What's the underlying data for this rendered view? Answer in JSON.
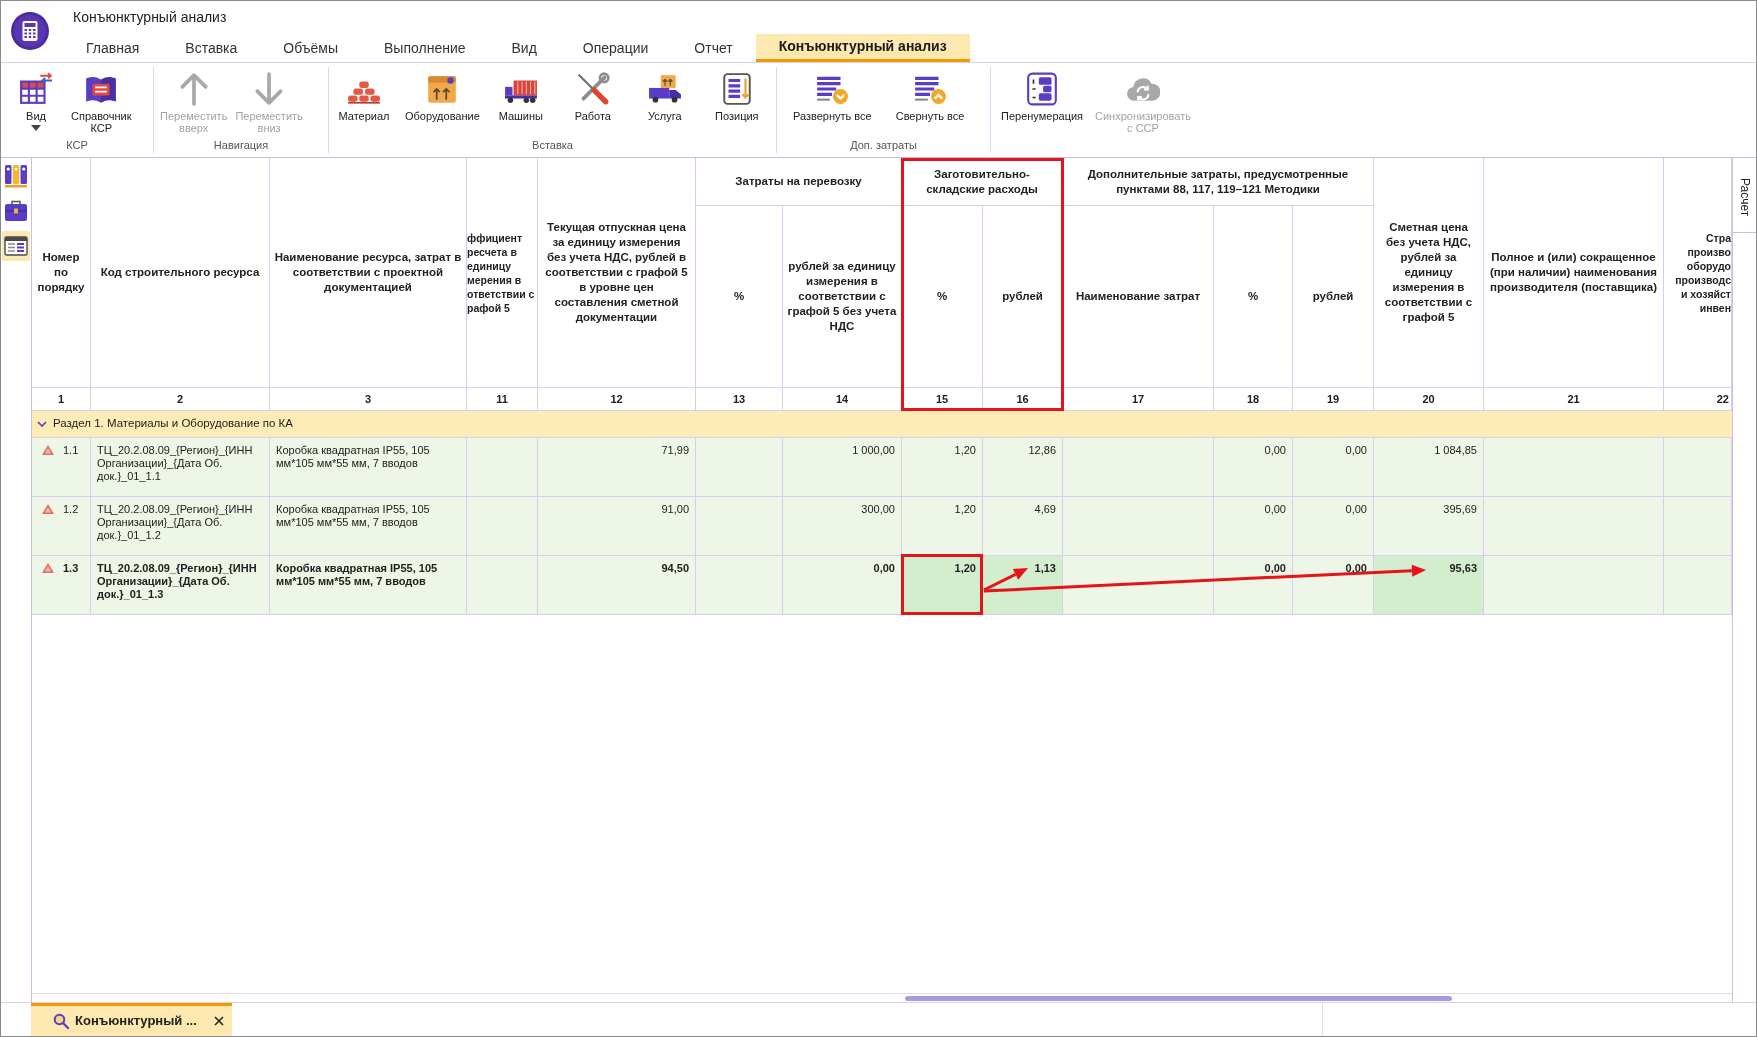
{
  "app": {
    "title": "Конъюнктурный анализ"
  },
  "tabs": [
    {
      "label": "Главная",
      "selected": false
    },
    {
      "label": "Вставка",
      "selected": false
    },
    {
      "label": "Объёмы",
      "selected": false
    },
    {
      "label": "Выполнение",
      "selected": false
    },
    {
      "label": "Вид",
      "selected": false
    },
    {
      "label": "Операции",
      "selected": false
    },
    {
      "label": "Отчет",
      "selected": false
    },
    {
      "label": "Конъюнктурный анализ",
      "selected": true
    }
  ],
  "ribbon": {
    "groups": [
      {
        "label": "КСР",
        "buttons": [
          {
            "label": "Вид",
            "dropdown": true,
            "disabled": false
          },
          {
            "label": "Справочник\nКСР",
            "dropdown": false,
            "disabled": false
          }
        ]
      },
      {
        "label": "Навигация",
        "buttons": [
          {
            "label": "Переместить\nвверх",
            "dropdown": false,
            "disabled": true
          },
          {
            "label": "Переместить\nвниз",
            "dropdown": false,
            "disabled": true
          }
        ]
      },
      {
        "label": "Вставка",
        "buttons": [
          {
            "label": "Материал",
            "dropdown": false,
            "disabled": false
          },
          {
            "label": "Оборудование",
            "dropdown": false,
            "disabled": false
          },
          {
            "label": "Машины",
            "dropdown": false,
            "disabled": false
          },
          {
            "label": "Работа",
            "dropdown": false,
            "disabled": false
          },
          {
            "label": "Услуга",
            "dropdown": false,
            "disabled": false
          },
          {
            "label": "Позиция",
            "dropdown": false,
            "disabled": false
          }
        ]
      },
      {
        "label": "Доп. затраты",
        "buttons": [
          {
            "label": "Развернуть все",
            "dropdown": false,
            "disabled": false
          },
          {
            "label": "Свернуть все",
            "dropdown": false,
            "disabled": false
          }
        ]
      },
      {
        "buttons": [
          {
            "label": "Перенумерация",
            "dropdown": false,
            "disabled": false
          },
          {
            "label": "Синхронизировать\nс ССР",
            "dropdown": false,
            "disabled": true
          }
        ]
      }
    ]
  },
  "side_tools": [
    {
      "selected": false
    },
    {
      "selected": false
    },
    {
      "selected": true
    }
  ],
  "table": {
    "header": [
      {
        "label": "Номер по порядку",
        "number": "1"
      },
      {
        "label": "Код строительного ресурса",
        "number": "2"
      },
      {
        "label": "Наименование ресурса, затрат в соответствии с проектной документацией",
        "number": "3"
      },
      {
        "label": "ффициент\nресчета в\nединицу\nмерения в\nответствии с\nрафой 5",
        "number": "11"
      },
      {
        "label": "Текущая отпускная цена за единицу измерения без учета НДС, рублей в соответствии с графой 5 в уровне цен составления сметной документации",
        "number": "12"
      },
      {
        "label": "Затраты на перевозку",
        "children": [
          {
            "label": "%",
            "number": "13"
          },
          {
            "label": "рублей за единицу измерения в соответствии с графой 5 без учета НДС",
            "number": "14"
          }
        ]
      },
      {
        "label": "Заготовительно-складские расходы",
        "children": [
          {
            "label": "%",
            "number": "15"
          },
          {
            "label": "рублей",
            "number": "16"
          }
        ]
      },
      {
        "label": "Дополнительные затраты, предусмотренные пунктами 88, 117, 119–121 Методики",
        "children": [
          {
            "label": "Наименование затрат",
            "number": "17"
          },
          {
            "label": "%",
            "number": "18"
          },
          {
            "label": "рублей",
            "number": "19"
          }
        ]
      },
      {
        "label": "Сметная цена без учета НДС, рублей за единицу измерения в соответствии с графой 5",
        "number": "20"
      },
      {
        "label": "Полное и (или) сокращенное (при наличии) наименования производителя (поставщика)",
        "number": "21"
      },
      {
        "label": "Стра\nпроизво\nоборудо\nпроизводс\nи хозяйст\nинвен",
        "number": "22"
      }
    ],
    "sections": [
      {
        "title": "Раздел 1. Материалы и Оборудование по КА",
        "expanded": true,
        "rows": [
          {
            "number": "1.1",
            "flagged": true,
            "selected": false,
            "cells": [
              {
                "value": "ТЦ_20.2.08.09_{Регион}_{ИНН Организации}_{Дата Об. док.}_01_1.1",
                "highlighted": false
              },
              {
                "value": "Коробка квадратная IP55, 105 мм*105 мм*55 мм, 7 вводов",
                "highlighted": false
              },
              {
                "highlighted": false
              },
              {
                "value": "71,99",
                "highlighted": false
              },
              {
                "highlighted": false
              },
              {
                "value": "1 000,00",
                "highlighted": false
              },
              {
                "value": "1,20",
                "highlighted": false
              },
              {
                "value": "12,86",
                "highlighted": false
              },
              {
                "highlighted": false
              },
              {
                "value": "0,00",
                "highlighted": false
              },
              {
                "value": "0,00",
                "highlighted": false
              },
              {
                "value": "1 084,85",
                "highlighted": false
              },
              {
                "highlighted": false
              },
              {
                "highlighted": false
              }
            ]
          },
          {
            "number": "1.2",
            "flagged": true,
            "selected": false,
            "cells": [
              {
                "value": "ТЦ_20.2.08.09_{Регион}_{ИНН Организации}_{Дата Об. док.}_01_1.2",
                "highlighted": false
              },
              {
                "value": "Коробка квадратная IP55, 105 мм*105 мм*55 мм, 7 вводов",
                "highlighted": false
              },
              {
                "highlighted": false
              },
              {
                "value": "91,00",
                "highlighted": false
              },
              {
                "highlighted": false
              },
              {
                "value": "300,00",
                "highlighted": false
              },
              {
                "value": "1,20",
                "highlighted": false
              },
              {
                "value": "4,69",
                "highlighted": false
              },
              {
                "highlighted": false
              },
              {
                "value": "0,00",
                "highlighted": false
              },
              {
                "value": "0,00",
                "highlighted": false
              },
              {
                "value": "395,69",
                "highlighted": false
              },
              {
                "highlighted": false
              },
              {
                "highlighted": false
              }
            ]
          },
          {
            "number": "1.3",
            "flagged": true,
            "selected": true,
            "cells": [
              {
                "value": "ТЦ_20.2.08.09_{Регион}_{ИНН Организации}_{Дата Об. док.}_01_1.3",
                "highlighted": false
              },
              {
                "value": "Коробка квадратная IP55, 105 мм*105 мм*55 мм, 7 вводов",
                "highlighted": false
              },
              {
                "highlighted": false
              },
              {
                "value": "94,50",
                "highlighted": false
              },
              {
                "highlighted": false
              },
              {
                "value": "0,00",
                "highlighted": false
              },
              {
                "value": "1,20",
                "highlighted": true
              },
              {
                "value": "1,13",
                "highlighted": true
              },
              {
                "highlighted": false
              },
              {
                "value": "0,00",
                "highlighted": false
              },
              {
                "value": "0,00",
                "highlighted": false
              },
              {
                "value": "95,63",
                "highlighted": true
              },
              {
                "highlighted": false
              },
              {
                "highlighted": false
              }
            ]
          }
        ]
      }
    ]
  },
  "annotations": [
    {
      "kind": "frame"
    },
    {
      "kind": "frame"
    },
    {
      "kind": "arrow"
    },
    {
      "kind": "arrow"
    }
  ],
  "side_panel": {
    "tab": {
      "label": "Расчет"
    }
  },
  "document_tabs": [
    {
      "label": "Конъюнктурный ...",
      "selected": true
    }
  ]
}
